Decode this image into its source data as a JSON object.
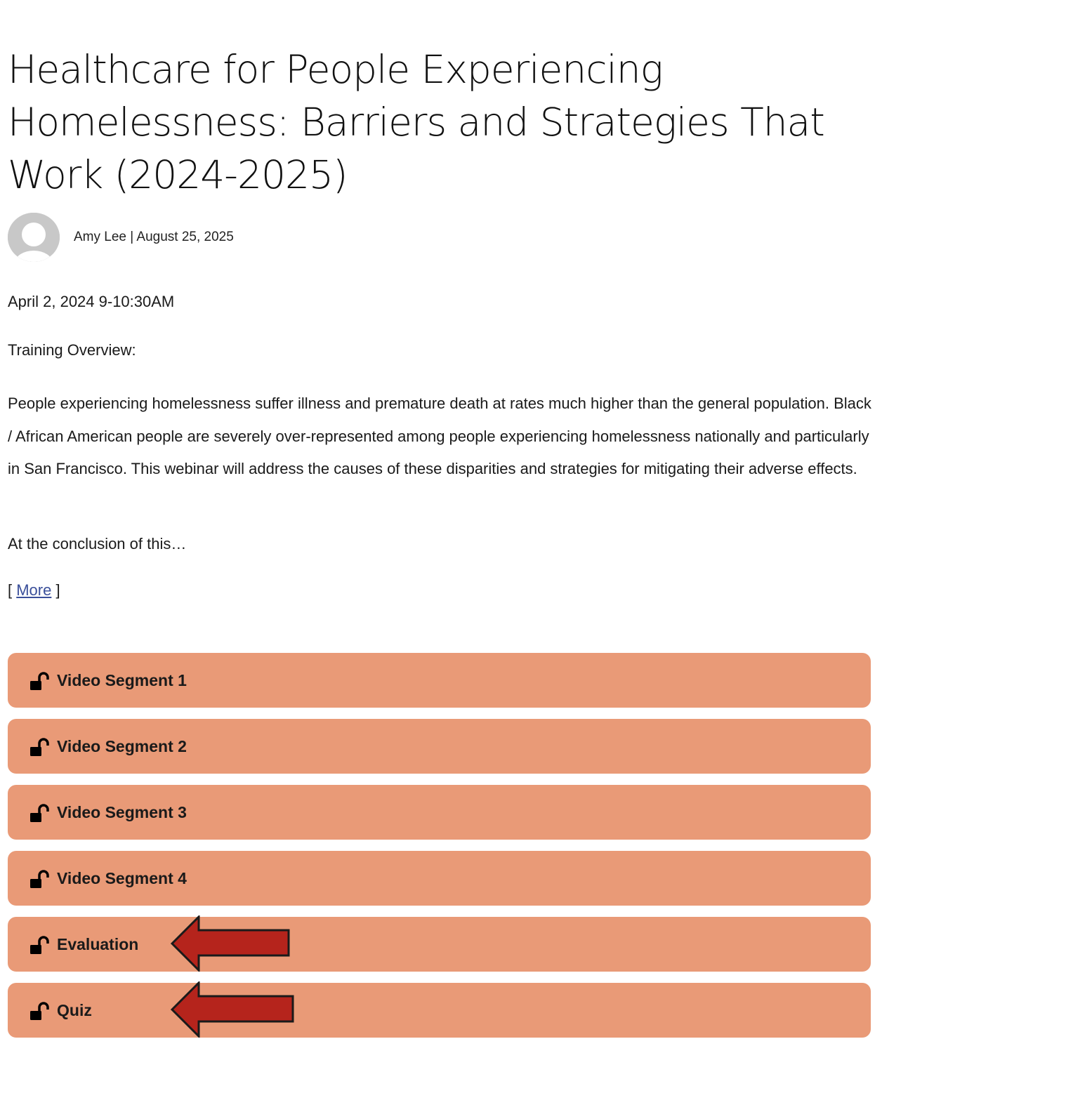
{
  "post": {
    "title": "Healthcare for People Experiencing Homelessness: Barriers and Strategies That Work (2024-2025)",
    "byline": "Amy Lee | August 25, 2025",
    "avatar_icon": "user-silhouette-icon",
    "event_date": "April 2, 2024 9-10:30AM",
    "overview_label": "Training Overview:",
    "description": "People experiencing homelessness suffer illness and premature death at rates much higher than the general population. Black / African American people are severely over-represented among people experiencing homelessness nationally and particularly in San Francisco. This webinar will address the causes of these disparities and strategies for mitigating their adverse effects.",
    "conclusion": "At the conclusion of this…",
    "more_open": "[ ",
    "more_label": "More",
    "more_close": " ]"
  },
  "segments": [
    {
      "label": "Video Segment 1",
      "icon": "unlock-icon"
    },
    {
      "label": "Video Segment 2",
      "icon": "unlock-icon"
    },
    {
      "label": "Video Segment 3",
      "icon": "unlock-icon"
    },
    {
      "label": "Video Segment 4",
      "icon": "unlock-icon"
    },
    {
      "label": "Evaluation",
      "icon": "unlock-icon",
      "annotation": "red-arrow-pointer"
    },
    {
      "label": "Quiz",
      "icon": "unlock-icon",
      "annotation": "red-arrow-pointer"
    }
  ],
  "colors": {
    "button_bg": "#e99a77",
    "arrow_fill": "#b5241c",
    "link": "#3a4f9a"
  }
}
